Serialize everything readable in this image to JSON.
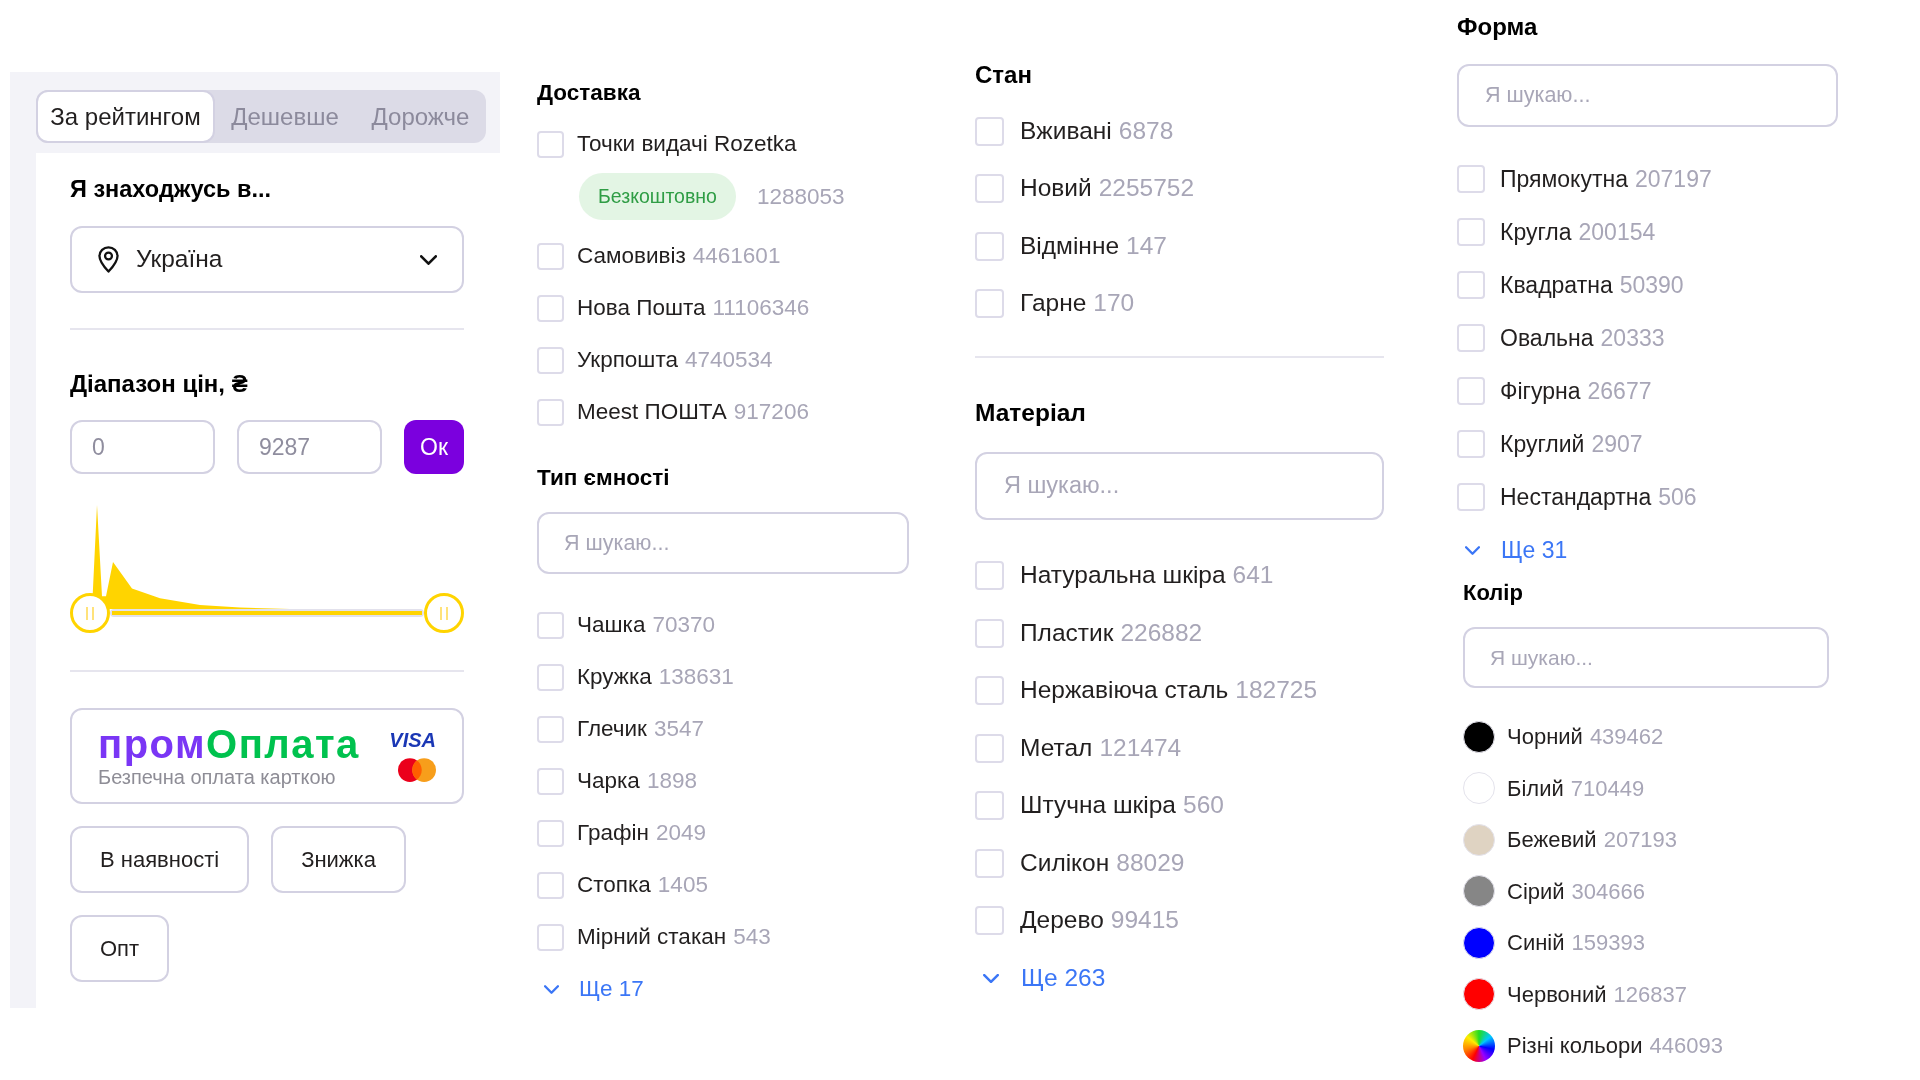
{
  "sort_tabs": [
    {
      "label": "За рейтингом",
      "selected": true
    },
    {
      "label": "Дешевше",
      "selected": false
    },
    {
      "label": "Дорожче",
      "selected": false
    }
  ],
  "location": {
    "title": "Я знаходжусь в...",
    "value": "Україна"
  },
  "price_range": {
    "title": "Діапазон цін, ₴",
    "min": {
      "placeholder": "0"
    },
    "max": {
      "placeholder": "9287"
    },
    "button": "Ок",
    "slider": {
      "level": 1
    }
  },
  "payment_banner": {
    "brand": [
      "пром",
      "Оплата"
    ],
    "tagline": "Безпечна оплата карткою",
    "card_logo": "VISA"
  },
  "quick_filters": [
    "В наявності",
    "Знижка",
    "Опт"
  ],
  "delivery": {
    "title": "Доставка",
    "options": [
      {
        "label": "Точки видачі Rozetka",
        "badge": "Безкоштовно",
        "count": "1288053",
        "checked": false
      },
      {
        "label": "Самовивіз",
        "count": "4461601",
        "checked": false
      },
      {
        "label": "Нова Пошта",
        "count": "11106346",
        "checked": false
      },
      {
        "label": "Укрпошта",
        "count": "4740534",
        "checked": false
      },
      {
        "label": "Meest ПОШТА",
        "count": "917206",
        "checked": false
      }
    ]
  },
  "container_type": {
    "title": "Тип ємності",
    "search": {
      "placeholder": "Я шукаю..."
    },
    "options": [
      {
        "label": "Чашка",
        "count": "70370",
        "checked": false
      },
      {
        "label": "Кружка",
        "count": "138631",
        "checked": false
      },
      {
        "label": "Глечик",
        "count": "3547",
        "checked": false
      },
      {
        "label": "Чарка",
        "count": "1898",
        "checked": false
      },
      {
        "label": "Графін",
        "count": "2049",
        "checked": false
      },
      {
        "label": "Стопка",
        "count": "1405",
        "checked": false
      },
      {
        "label": "Мірний стакан",
        "count": "543",
        "checked": false
      }
    ],
    "more": "Ще 17"
  },
  "condition": {
    "title": "Стан",
    "options": [
      {
        "label": "Вживані",
        "count": "6878",
        "checked": false
      },
      {
        "label": "Новий",
        "count": "2255752",
        "checked": false
      },
      {
        "label": "Відмінне",
        "count": "147",
        "checked": false
      },
      {
        "label": "Гарне",
        "count": "170",
        "checked": false
      }
    ]
  },
  "material": {
    "title": "Матеріал",
    "search": {
      "placeholder": "Я шукаю..."
    },
    "options": [
      {
        "label": "Натуральна шкіра",
        "count": "641",
        "checked": false
      },
      {
        "label": "Пластик",
        "count": "226882",
        "checked": false
      },
      {
        "label": "Нержавіюча сталь",
        "count": "182725",
        "checked": false
      },
      {
        "label": "Метал",
        "count": "121474",
        "checked": false
      },
      {
        "label": "Штучна шкіра",
        "count": "560",
        "checked": false
      },
      {
        "label": "Силікон",
        "count": "88029",
        "checked": false
      },
      {
        "label": "Дерево",
        "count": "99415",
        "checked": false
      }
    ],
    "more": "Ще 263"
  },
  "shape": {
    "title": "Форма",
    "search": {
      "placeholder": "Я шукаю..."
    },
    "options": [
      {
        "label": "Прямокутна",
        "count": "207197",
        "checked": false
      },
      {
        "label": "Кругла",
        "count": "200154",
        "checked": false
      },
      {
        "label": "Квадратна",
        "count": "50390",
        "checked": false
      },
      {
        "label": "Овальна",
        "count": "20333",
        "checked": false
      },
      {
        "label": "Фігурна",
        "count": "26677",
        "checked": false
      },
      {
        "label": "Круглий",
        "count": "2907",
        "checked": false
      },
      {
        "label": "Нестандартна",
        "count": "506",
        "checked": false
      }
    ],
    "more": "Ще 31"
  },
  "color": {
    "title": "Колір",
    "search": {
      "placeholder": "Я шукаю..."
    },
    "options": [
      {
        "kind": "solid",
        "label": "Чорний",
        "count": "439462",
        "color": "#000000"
      },
      {
        "kind": "solid",
        "label": "Білий",
        "count": "710449",
        "color": "#ffffff"
      },
      {
        "kind": "solid",
        "label": "Бежевий",
        "count": "207193",
        "color": "#dfd3c2"
      },
      {
        "kind": "solid",
        "label": "Сірий",
        "count": "304666",
        "color": "#868686"
      },
      {
        "kind": "solid",
        "label": "Синій",
        "count": "159393",
        "color": "#0000ff"
      },
      {
        "kind": "solid",
        "label": "Червоний",
        "count": "126837",
        "color": "#ff0000"
      },
      {
        "kind": "multicolor",
        "label": "Різні кольори",
        "count": "446093"
      }
    ]
  }
}
